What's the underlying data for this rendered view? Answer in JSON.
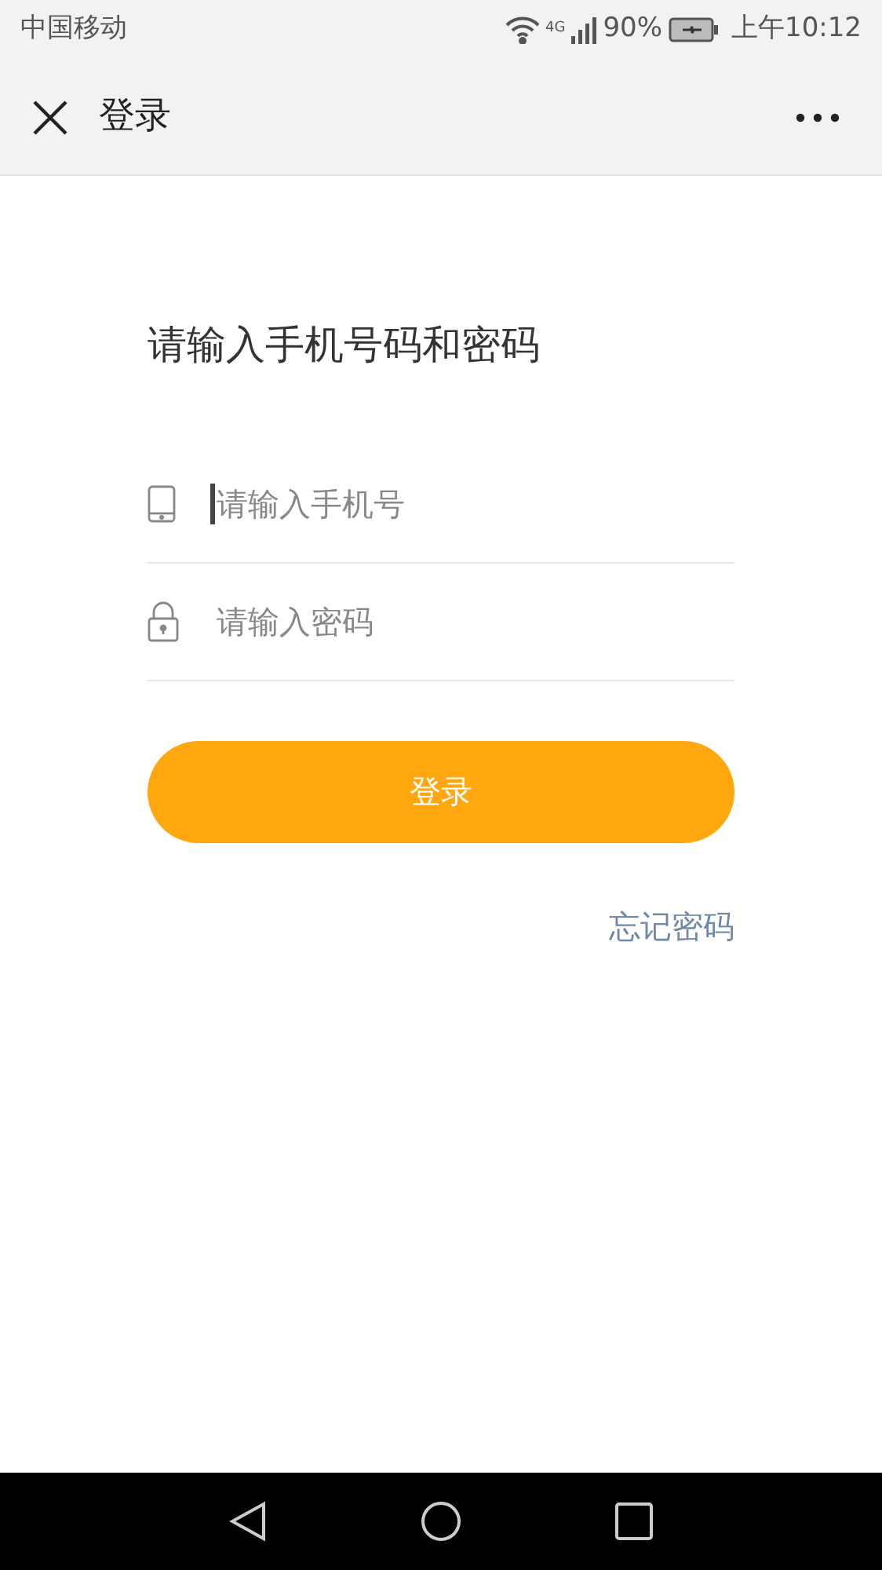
{
  "status_bar": {
    "carrier": "中国移动",
    "network": "4G",
    "battery": "90%",
    "time": "上午10:12"
  },
  "header": {
    "title": "登录"
  },
  "heading": "请输入手机号码和密码",
  "fields": [
    {
      "kind": "phone",
      "placeholder": "请输入手机号",
      "focused": true
    },
    {
      "kind": "password",
      "placeholder": "请输入密码",
      "focused": false
    }
  ],
  "login_button": "登录",
  "forgot_link": "忘记密码"
}
